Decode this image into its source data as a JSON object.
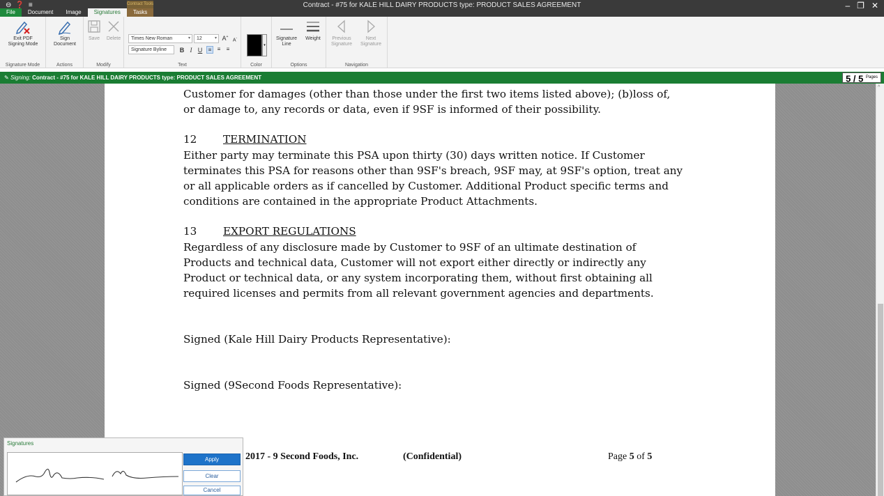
{
  "window": {
    "title": "Contract - #75 for KALE HILL DAIRY PRODUCTS type: PRODUCT SALES AGREEMENT",
    "minimize": "–",
    "restore": "❐",
    "close": "✕"
  },
  "menu_tabs": [
    "File",
    "Document",
    "Image",
    "Signatures",
    "Tasks"
  ],
  "contextual_tab_label": "Contract Tools",
  "ribbon": {
    "exit_pdf": "Exit PDF\nSigning Mode",
    "sign_document": "Sign\nDocument",
    "save": "Save",
    "delete": "Delete",
    "font_family": "Times New Roman",
    "font_size": "12",
    "style": "Signature Byline",
    "bold": "B",
    "italic": "I",
    "underline": "U",
    "signature_line": "Signature\nLine",
    "weight": "Weight",
    "previous_signature": "Previous\nSignature",
    "next_signature": "Next\nSignature",
    "groups": {
      "signature_mode": "Signature Mode",
      "actions": "Actions",
      "modify": "Modify",
      "text": "Text",
      "color": "Color",
      "options": "Options",
      "navigation": "Navigation"
    },
    "current_color": "#000000"
  },
  "signing_bar": {
    "prefix": "Signing:",
    "text": "Contract - #75 for KALE HILL DAIRY PRODUCTS type: PRODUCT SALES AGREEMENT"
  },
  "page_counter": {
    "current": "5 / 5",
    "label": "Pages"
  },
  "document": {
    "intro_lines": [
      "Customer for damages (other than those under the first two items listed above); (b)loss of,",
      "or damage to, any records or data, even if 9SF is informed of their possibility."
    ],
    "section12": {
      "number": "12",
      "title": "TERMINATION",
      "lines": [
        "Either party may terminate this PSA upon thirty (30) days written notice. If Customer",
        "terminates this PSA for reasons other than 9SF's breach, 9SF may, at 9SF's option, treat any",
        "or all applicable orders as if cancelled by Customer. Additional Product specific terms and",
        "conditions are contained in the appropriate Product Attachments."
      ]
    },
    "section13": {
      "number": "13",
      "title": "EXPORT REGULATIONS",
      "lines": [
        "Regardless of any disclosure made by Customer to 9SF of an ultimate destination of",
        "Products and technical data, Customer will not export either directly or indirectly any",
        "Product or technical data, or any system incorporating them, without first obtaining all",
        "required licenses and permits from all relevant government agencies and departments."
      ]
    },
    "signed_customer": "Signed (Kale Hill Dairy Products Representative):",
    "signed_vendor": "Signed (9Second Foods Representative):",
    "footer_company": "2017  - 9 Second Foods, Inc.",
    "footer_confidential": "(Confidential)",
    "footer_page_prefix": "Page ",
    "footer_page_num": "5",
    "footer_page_of": " of ",
    "footer_page_total": "5"
  },
  "signatures_panel": {
    "title": "Signatures",
    "apply": "Apply",
    "clear": "Clear",
    "cancel": "Cancel"
  }
}
